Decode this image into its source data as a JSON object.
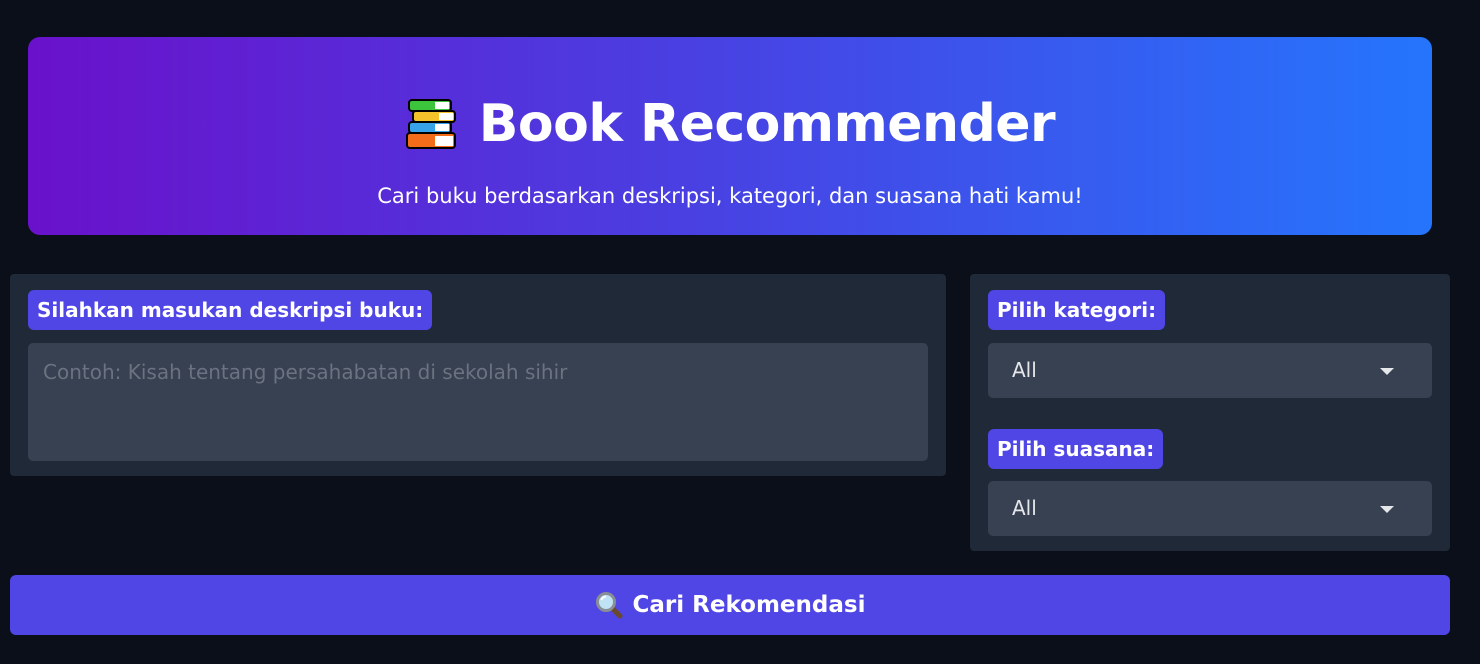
{
  "header": {
    "icon": "books-icon",
    "title": "Book Recommender",
    "subtitle": "Cari buku berdasarkan deskripsi, kategori, dan suasana hati kamu!"
  },
  "description": {
    "label": "Silahkan masukan deskripsi buku:",
    "value": "",
    "placeholder": "Contoh: Kisah tentang persahabatan di sekolah sihir"
  },
  "category": {
    "label": "Pilih kategori:",
    "selected": "All"
  },
  "mood": {
    "label": "Pilih suasana:",
    "selected": "All"
  },
  "search_button": {
    "icon": "magnifier-icon",
    "label": "Cari Rekomendasi"
  },
  "colors": {
    "background": "#0b0f19",
    "gradient_start": "#6a11cb",
    "gradient_end": "#2575fc",
    "accent": "#4f46e5",
    "panel": "#1f2937",
    "input": "#374151"
  }
}
